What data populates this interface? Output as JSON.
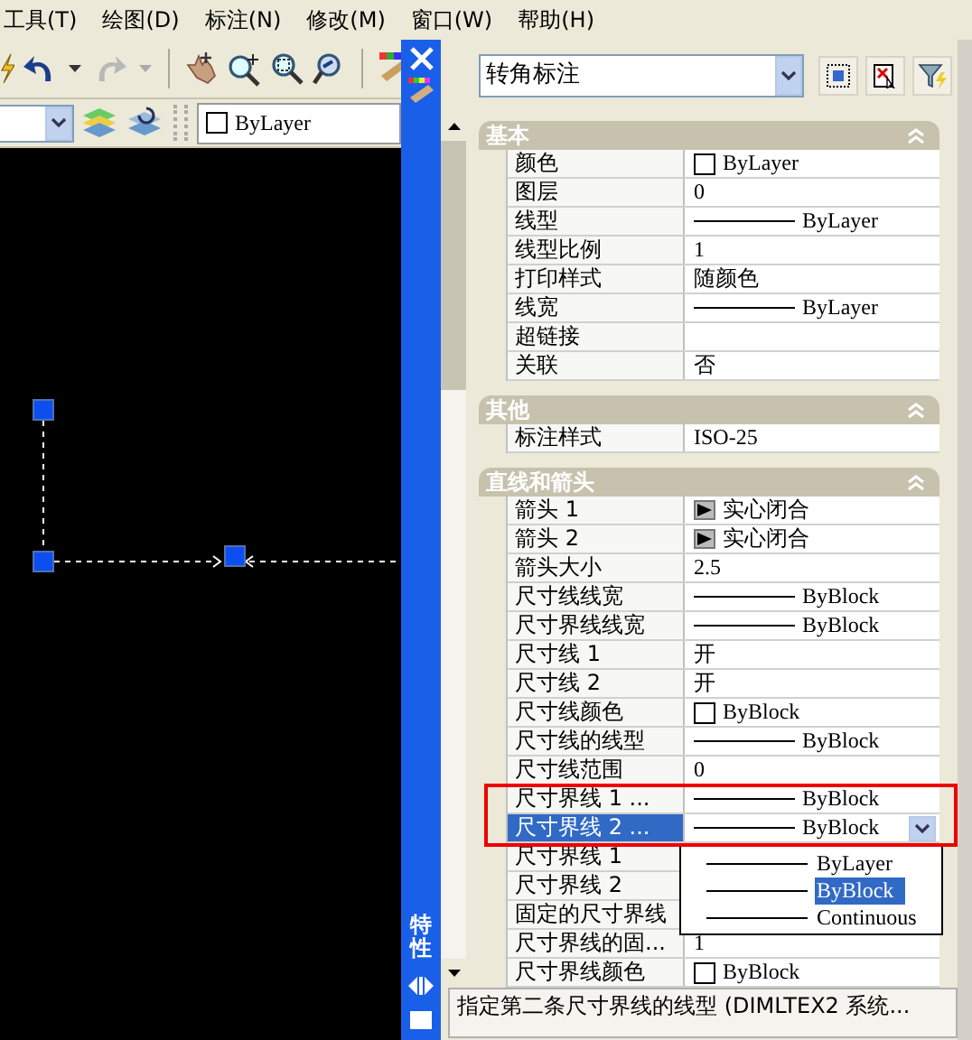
{
  "menu": [
    {
      "label": "工具(T)"
    },
    {
      "label": "绘图(D)"
    },
    {
      "label": "标注(N)"
    },
    {
      "label": "修改(M)"
    },
    {
      "label": "窗口(W)"
    },
    {
      "label": "帮助(H)"
    }
  ],
  "layer_combo": {
    "value": "ByLayer"
  },
  "palette": {
    "title": "特性",
    "object_type": "转角标注",
    "sections": [
      {
        "title": "基本",
        "expanded": true,
        "rows": [
          {
            "name": "颜色",
            "kind": "color",
            "value": "ByLayer",
            "selected": false
          },
          {
            "name": "图层",
            "kind": "text",
            "value": "0",
            "selected": false
          },
          {
            "name": "线型",
            "kind": "linetype",
            "value": "ByLayer",
            "selected": false
          },
          {
            "name": "线型比例",
            "kind": "text",
            "value": "1",
            "selected": false
          },
          {
            "name": "打印样式",
            "kind": "text",
            "value": "随颜色",
            "selected": false
          },
          {
            "name": "线宽",
            "kind": "linetype",
            "value": "ByLayer",
            "selected": false
          },
          {
            "name": "超链接",
            "kind": "text",
            "selected": false
          },
          {
            "name": "关联",
            "kind": "text",
            "value": "否",
            "selected": false
          }
        ]
      },
      {
        "title": "其他",
        "expanded": true,
        "rows": [
          {
            "name": "标注样式",
            "kind": "text",
            "value": "ISO-25",
            "selected": false
          }
        ]
      },
      {
        "title": "直线和箭头",
        "expanded": true,
        "rows": [
          {
            "name": "箭头 1",
            "kind": "arrow",
            "value": "实心闭合",
            "selected": false
          },
          {
            "name": "箭头 2",
            "kind": "arrow",
            "value": "实心闭合",
            "selected": false
          },
          {
            "name": "箭头大小",
            "kind": "text",
            "value": "2.5",
            "selected": false
          },
          {
            "name": "尺寸线线宽",
            "kind": "linetype",
            "value": "ByBlock",
            "selected": false
          },
          {
            "name": "尺寸界线线宽",
            "kind": "linetype",
            "value": "ByBlock",
            "selected": false
          },
          {
            "name": "尺寸线 1",
            "kind": "text",
            "value": "开",
            "selected": false
          },
          {
            "name": "尺寸线 2",
            "kind": "text",
            "value": "开",
            "selected": false
          },
          {
            "name": "尺寸线颜色",
            "kind": "color",
            "value": "ByBlock",
            "selected": false
          },
          {
            "name": "尺寸线的线型",
            "kind": "linetype",
            "value": "ByBlock",
            "selected": false
          },
          {
            "name": "尺寸线范围",
            "kind": "text",
            "value": "0",
            "selected": false
          },
          {
            "name": "尺寸界线 1 ...",
            "kind": "linetype",
            "value": "ByBlock",
            "selected": false
          },
          {
            "name": "尺寸界线 2 ...",
            "kind": "linetype",
            "value": "ByBlock",
            "selected": true,
            "options": [
              {
                "label": "ByLayer",
                "selected": false
              },
              {
                "label": "ByBlock",
                "selected": true
              },
              {
                "label": "Continuous",
                "selected": false
              }
            ]
          },
          {
            "name": "尺寸界线 1",
            "kind": "text",
            "selected": false
          },
          {
            "name": "尺寸界线 2",
            "kind": "text",
            "selected": false
          },
          {
            "name": "固定的尺寸界线",
            "kind": "text",
            "selected": false
          },
          {
            "name": "尺寸界线的固...",
            "kind": "text",
            "value": "1",
            "selected": false
          },
          {
            "name": "尺寸界线颜色",
            "kind": "color",
            "value": "ByBlock",
            "selected": false
          }
        ]
      }
    ],
    "description": "指定第二条尺寸界线的线型 (DIMLTEX2 系统..."
  }
}
